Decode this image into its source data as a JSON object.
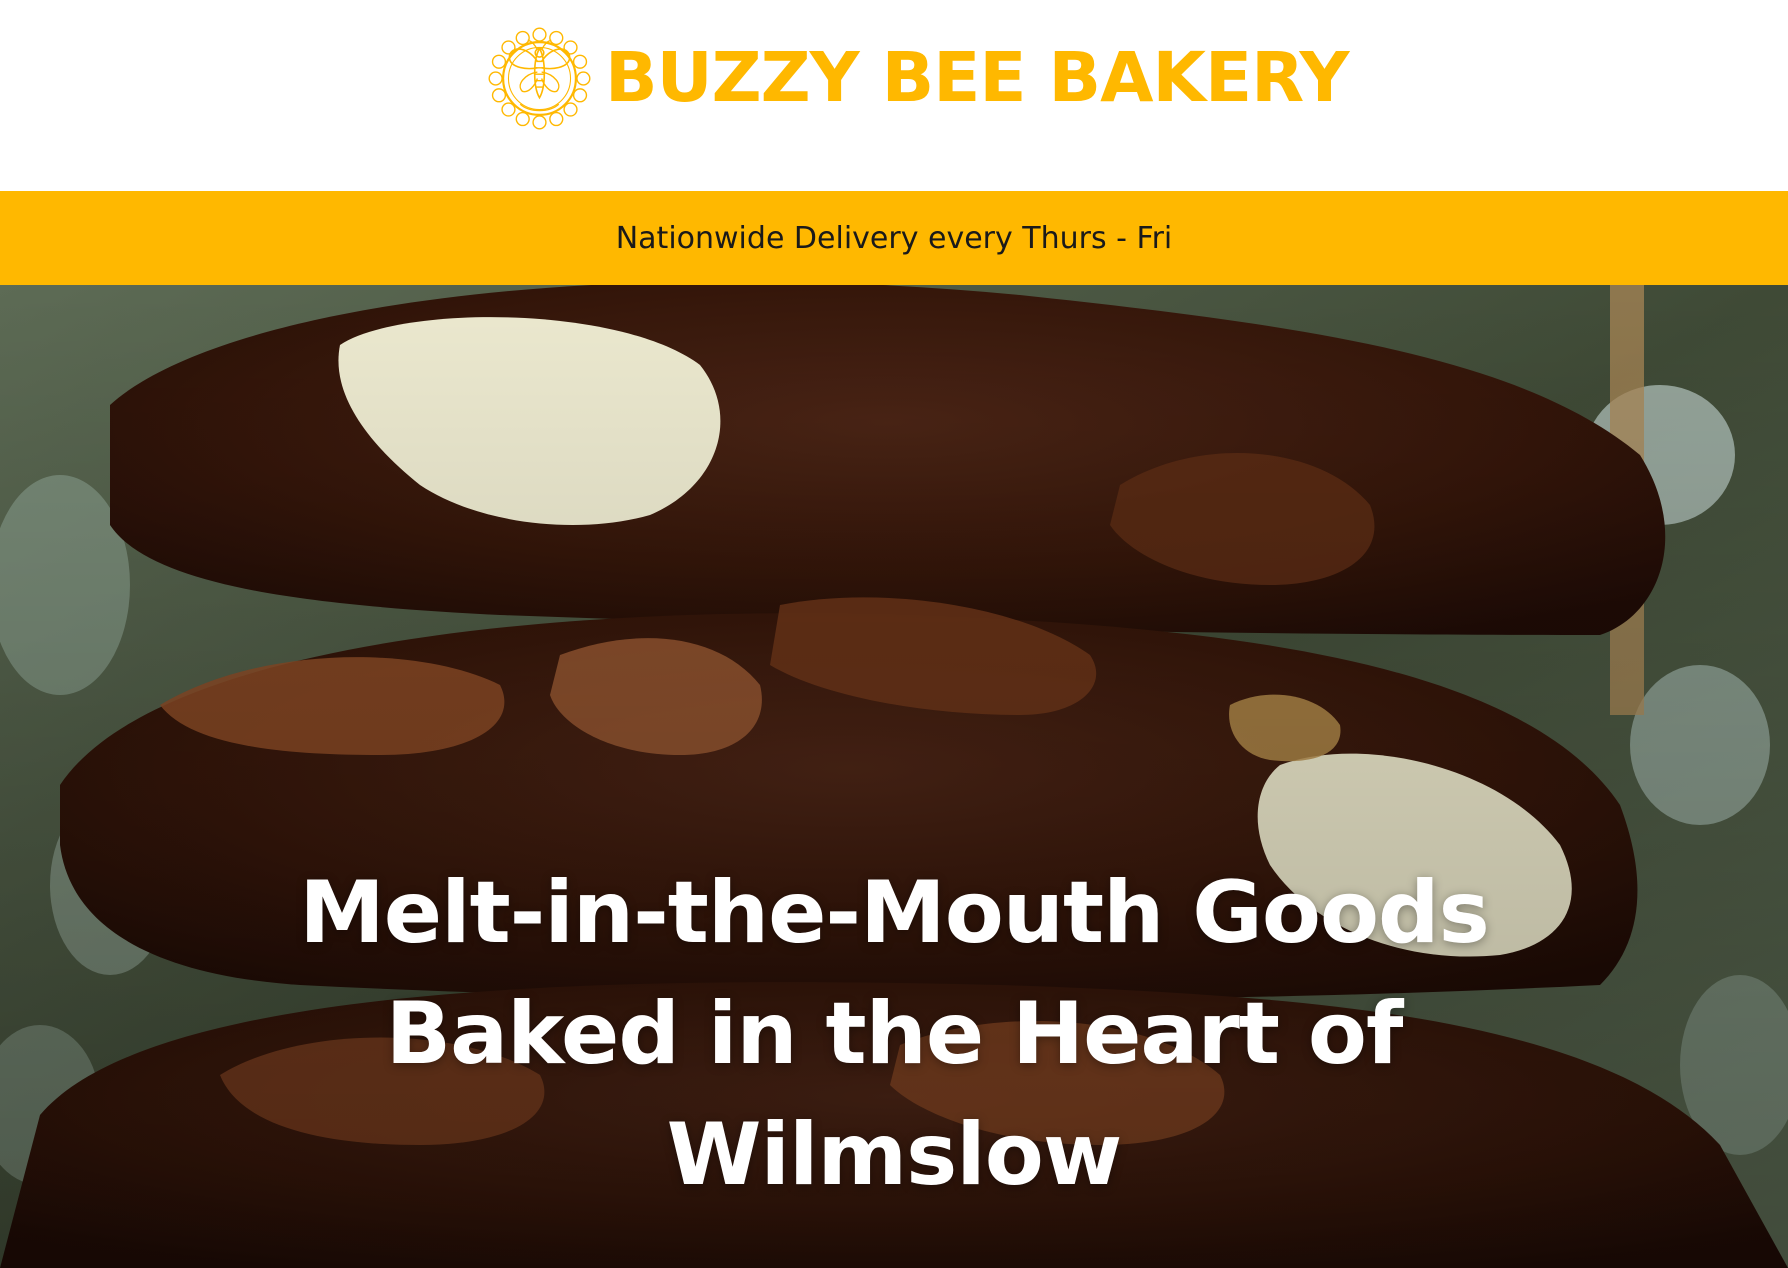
{
  "brand": {
    "name": "BUZZY BEE BAKERY",
    "logo_icon": "bee-emblem-icon",
    "color": "#FFB800"
  },
  "announcement": {
    "text": "Nationwide Delivery every Thurs - Fri",
    "background": "#FFB800"
  },
  "hero": {
    "image": "chocolate-cookies-stack-photo",
    "heading_lines": [
      "Melt-in-the-Mouth Goods",
      "Baked in the Heart of",
      "Wilmslow"
    ]
  }
}
